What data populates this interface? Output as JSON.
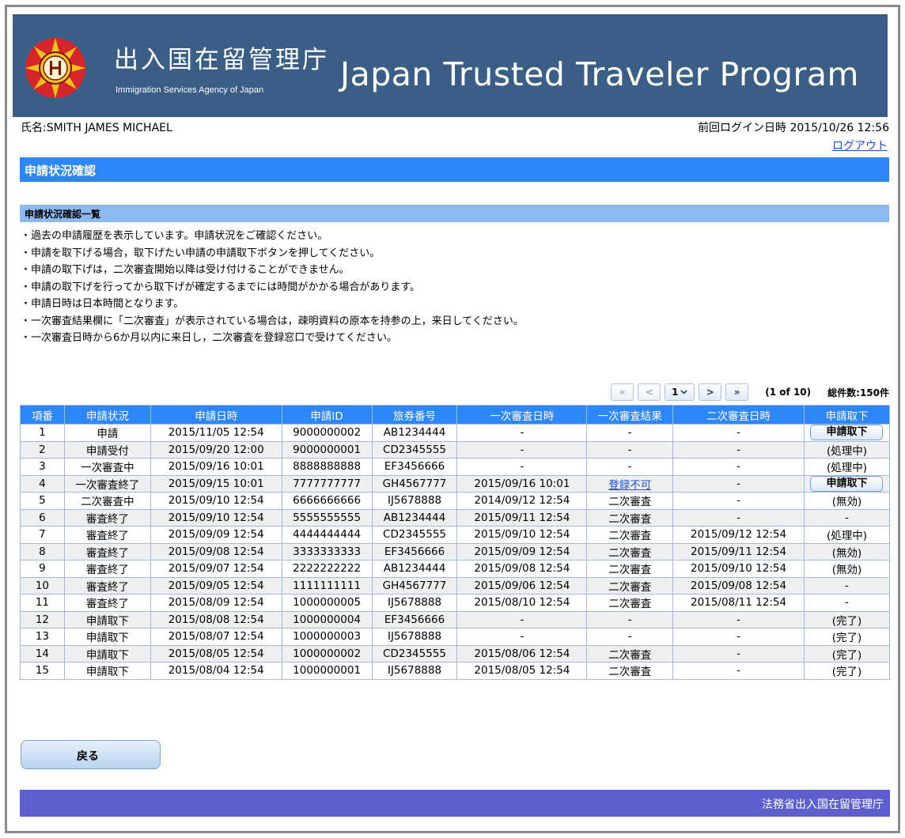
{
  "header": {
    "agency_jp": "出入国在留管理庁",
    "agency_en": "Immigration Services Agency of Japan",
    "program_title": "Japan Trusted Traveler Program"
  },
  "user_bar": {
    "user_name": "氏名:SMITH JAMES MICHAEL",
    "last_login": "前回ログイン日時  2015/10/26 12:56",
    "logout": "ログアウト"
  },
  "page_title": "申請状況確認",
  "section_title": "申請状況確認一覧",
  "notes": [
    "・過去の申請履歴を表示しています。申請状況をご確認ください。",
    "・申請を取下げる場合，取下げたい申請の申請取下ボタンを押してください。",
    "・申請の取下げは，二次審査開始以降は受け付けることができません。",
    "・申請の取下げを行ってから取下げが確定するまでには時間がかかる場合があります。",
    "・申請日時は日本時間となります。",
    "・一次審査結果欄に「二次審査」が表示されている場合は，疎明資料の原本を持参の上，来日してください。",
    "・一次審査日時から6か月以内に来日し，二次審査を登録窓口で受けてください。"
  ],
  "pagination": {
    "first": "«",
    "prev": "<",
    "current_page": "1",
    "next": ">",
    "last": "»",
    "page_info": "(1 of 10)",
    "total": "総件数:150件"
  },
  "table": {
    "headers": [
      "項番",
      "申請状況",
      "申請日時",
      "申請ID",
      "旅券番号",
      "一次審査日時",
      "一次審査結果",
      "二次審査日時",
      "申請取下"
    ],
    "rows": [
      [
        "1",
        "申請",
        "2015/11/05 12:54",
        "9000000002",
        "AB1234444",
        "-",
        "-",
        "-",
        "申請取下"
      ],
      [
        "2",
        "申請受付",
        "2015/09/20 12:00",
        "9000000001",
        "CD2345555",
        "-",
        "-",
        "-",
        "(処理中)"
      ],
      [
        "3",
        "一次審査中",
        "2015/09/16 10:01",
        "8888888888",
        "EF3456666",
        "-",
        "-",
        "-",
        "(処理中)"
      ],
      [
        "4",
        "一次審査終了",
        "2015/09/15 10:01",
        "7777777777",
        "GH4567777",
        "2015/09/16 10:01",
        "登録不可",
        "-",
        "申請取下"
      ],
      [
        "5",
        "二次審査中",
        "2015/09/10 12:54",
        "6666666666",
        "IJ5678888",
        "2014/09/12 12:54",
        "二次審査",
        "-",
        "(無効)"
      ],
      [
        "6",
        "審査終了",
        "2015/09/10 12:54",
        "5555555555",
        "AB1234444",
        "2015/09/11 12:54",
        "二次審査",
        "-",
        "-"
      ],
      [
        "7",
        "審査終了",
        "2015/09/09 12:54",
        "4444444444",
        "CD2345555",
        "2015/09/10 12:54",
        "二次審査",
        "2015/09/12 12:54",
        "(処理中)"
      ],
      [
        "8",
        "審査終了",
        "2015/09/08 12:54",
        "3333333333",
        "EF3456666",
        "2015/09/09 12:54",
        "二次審査",
        "2015/09/11 12:54",
        "(無効)"
      ],
      [
        "9",
        "審査終了",
        "2015/09/07 12:54",
        "2222222222",
        "AB1234444",
        "2015/09/08 12:54",
        "二次審査",
        "2015/09/10 12:54",
        "(無効)"
      ],
      [
        "10",
        "審査終了",
        "2015/09/05 12:54",
        "1111111111",
        "GH4567777",
        "2015/09/06 12:54",
        "二次審査",
        "2015/09/08 12:54",
        "-"
      ],
      [
        "11",
        "審査終了",
        "2015/08/09 12:54",
        "1000000005",
        "IJ5678888",
        "2015/08/10 12:54",
        "二次審査",
        "2015/08/11 12:54",
        "-"
      ],
      [
        "12",
        "申請取下",
        "2015/08/08 12:54",
        "1000000004",
        "EF3456666",
        "-",
        "-",
        "-",
        "(完了)"
      ],
      [
        "13",
        "申請取下",
        "2015/08/07 12:54",
        "1000000003",
        "IJ5678888",
        "-",
        "-",
        "-",
        "(完了)"
      ],
      [
        "14",
        "申請取下",
        "2015/08/05 12:54",
        "1000000002",
        "CD2345555",
        "2015/08/06 12:54",
        "二次審査",
        "-",
        "(完了)"
      ],
      [
        "15",
        "申請取下",
        "2015/08/04 12:54",
        "1000000001",
        "IJ5678888",
        "2015/08/05 12:54",
        "二次審査",
        "-",
        "(完了)"
      ]
    ]
  },
  "back_button": "戻る",
  "footer": "法務省出入国在留管理庁",
  "colors": {
    "header_bg": "#3b5e86",
    "title_bar": "#2f86f6",
    "section_bar": "#8db8f0",
    "footer_bg": "#5d5fce",
    "link": "#1a4fd8"
  }
}
